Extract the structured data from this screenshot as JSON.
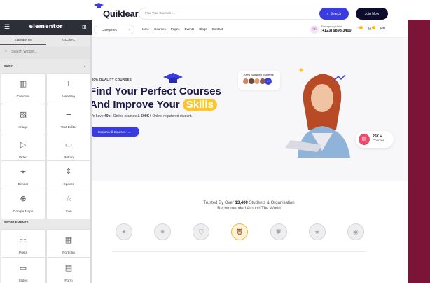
{
  "site": {
    "logo_text": "Quiklearn",
    "search_placeholder": "Find Your Courses ....",
    "search_button": "Search",
    "join_button": "Join Now",
    "categories_button": "Categories",
    "nav": [
      "Home",
      "Courses",
      "Pages",
      "Events",
      "Blogs",
      "Contact"
    ],
    "emergency_label": "Emergency Help!",
    "emergency_phone": "(+123) 9898 3400",
    "cart_total": "$00"
  },
  "hero": {
    "subtitle": "100% QUALITY COURSES",
    "title_line1_a": "Find Your",
    "title_line1_b": "Perfect",
    "title_line1_c": "Courses",
    "title_line2_a": "And Improve Your",
    "title_line2_pill": "Skills",
    "desc_a": "We have",
    "desc_b": "40k+",
    "desc_c": "Online courses &",
    "desc_d": "500K+",
    "desc_e": "Online registered student.",
    "cta": "Explore All Courses",
    "satisfied": "100% Satisfied Students",
    "satisfied_plus": "4+",
    "courses_count": "25K +",
    "courses_label": "Courses"
  },
  "trusted": {
    "line1_a": "Trusted By Over",
    "line1_b": "13,400",
    "line1_c": "Students & Organisation",
    "line2": "Recommended Around The World"
  },
  "elementor": {
    "title": "elementor",
    "tabs": [
      "ELEMENTS",
      "GLOBAL"
    ],
    "search_placeholder": "Search Widget...",
    "section_basic": "BASIC",
    "section_pro": "PRO ELEMENTS",
    "basic_widgets": [
      {
        "name": "Columns",
        "icon": "columns-icon"
      },
      {
        "name": "Heading",
        "icon": "heading-icon"
      },
      {
        "name": "Image",
        "icon": "image-icon"
      },
      {
        "name": "Text Editor",
        "icon": "text-editor-icon"
      },
      {
        "name": "Video",
        "icon": "video-icon"
      },
      {
        "name": "Button",
        "icon": "button-icon"
      },
      {
        "name": "Divider",
        "icon": "divider-icon"
      },
      {
        "name": "Spacer",
        "icon": "spacer-icon"
      },
      {
        "name": "Google Maps",
        "icon": "google-maps-icon"
      },
      {
        "name": "Icon",
        "icon": "star-icon"
      }
    ],
    "pro_widgets": [
      {
        "name": "Posts",
        "icon": "posts-icon"
      },
      {
        "name": "Portfolio",
        "icon": "portfolio-icon"
      },
      {
        "name": "Slides",
        "icon": "slides-icon"
      },
      {
        "name": "Form",
        "icon": "form-icon"
      }
    ]
  },
  "colors": {
    "primary": "#3b3ce0",
    "dark": "#0e0c2c",
    "heading": "#1b1a46",
    "accent_yellow": "#ffc52b",
    "maroon": "#7b1436",
    "elementor_header": "#2c2f38"
  }
}
